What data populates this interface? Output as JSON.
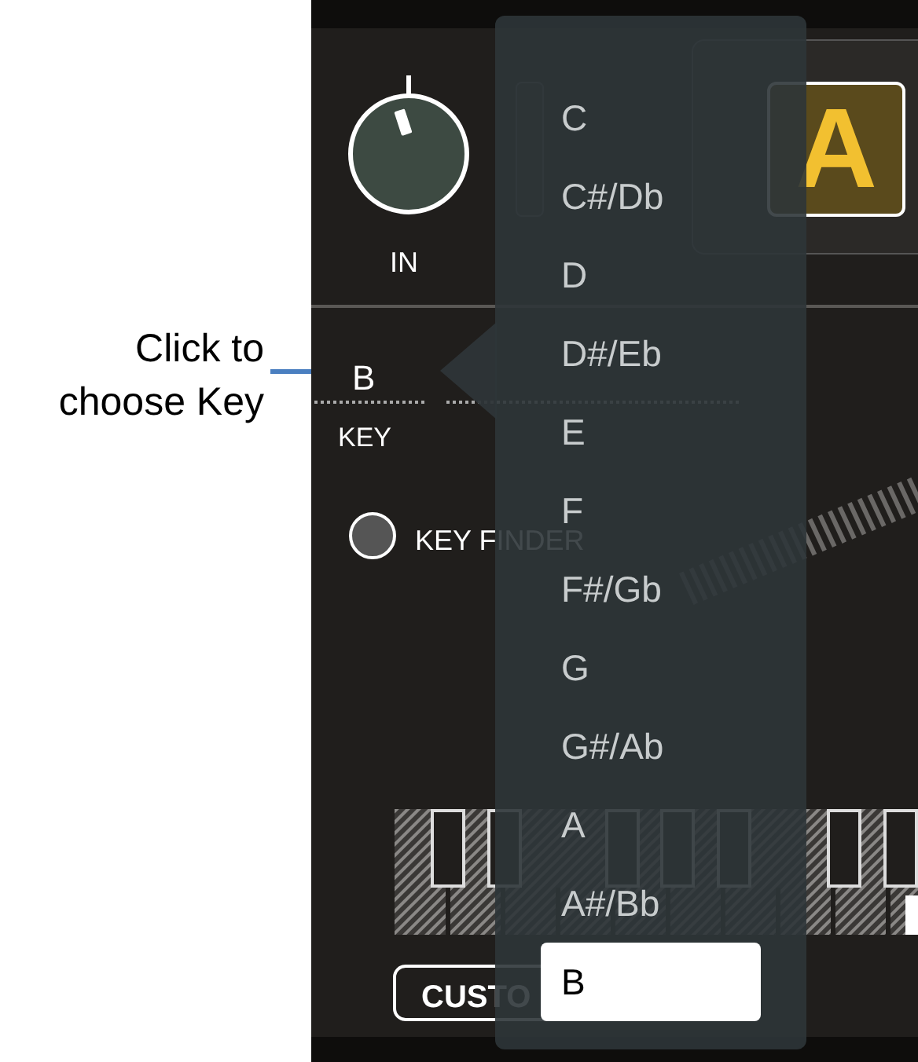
{
  "annotation": {
    "text": "Click to choose Key"
  },
  "input": {
    "label": "IN"
  },
  "display": {
    "letter": "A"
  },
  "key": {
    "value": "B",
    "label": "KEY"
  },
  "key_finder": {
    "label": "KEY FINDER",
    "on": false
  },
  "custom_button": {
    "label": "CUSTO"
  },
  "key_menu": [
    {
      "label": "C",
      "selected": false
    },
    {
      "label": "C#/Db",
      "selected": false
    },
    {
      "label": "D",
      "selected": false
    },
    {
      "label": "D#/Eb",
      "selected": false
    },
    {
      "label": "E",
      "selected": false
    },
    {
      "label": "F",
      "selected": false
    },
    {
      "label": "F#/Gb",
      "selected": false
    },
    {
      "label": "G",
      "selected": false
    },
    {
      "label": "G#/Ab",
      "selected": false
    },
    {
      "label": "A",
      "selected": false
    },
    {
      "label": "A#/Bb",
      "selected": false
    },
    {
      "label": "B",
      "selected": true
    }
  ]
}
